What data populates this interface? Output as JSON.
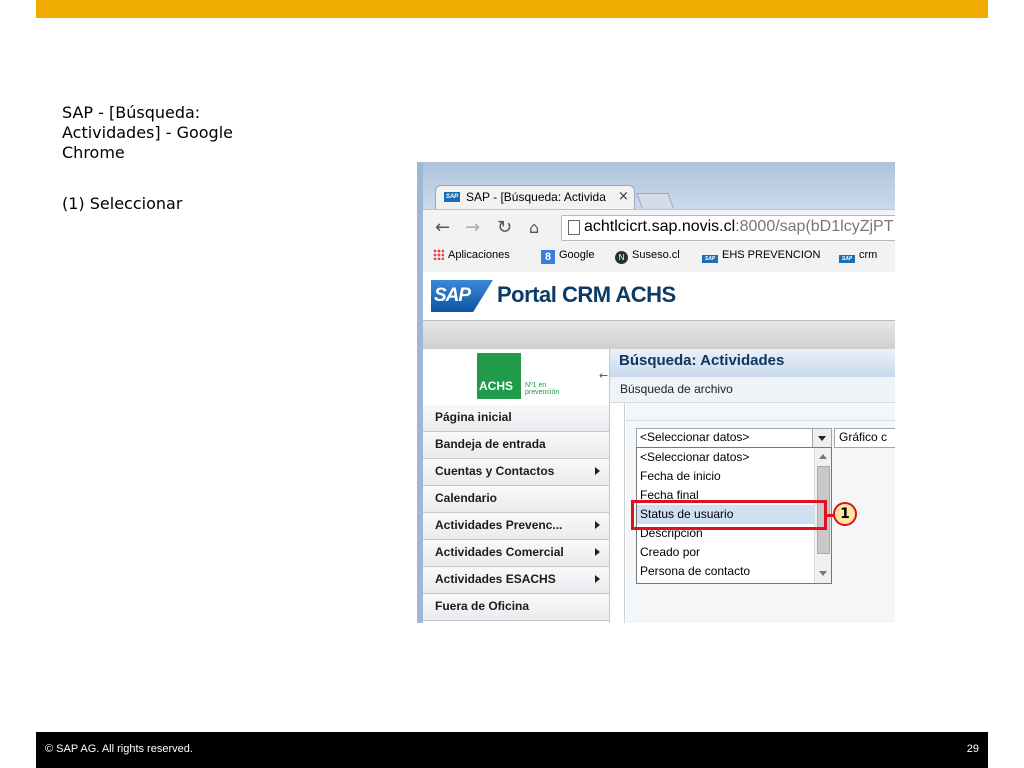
{
  "slide": {
    "title": "SAP - [Búsqueda: Actividades] - Google Chrome",
    "step": "(1) Seleccionar",
    "footer_copyright": "© SAP AG. All rights reserved.",
    "page_number": "29"
  },
  "browser": {
    "tab_title": "SAP - [Búsqueda: Activida",
    "tab_close": "×",
    "address_host": "achtlcicrt.sap.novis.cl",
    "address_path": ":8000/sap(bD1lcyZjPT",
    "bookmarks": [
      {
        "label": "Aplicaciones",
        "icon": "apps-icon"
      },
      {
        "label": "Google",
        "icon": "google-icon"
      },
      {
        "label": "Suseso.cl",
        "icon": "suseso-icon"
      },
      {
        "label": "EHS PREVENCION",
        "icon": "sap-icon"
      },
      {
        "label": "crm",
        "icon": "sap-icon"
      }
    ]
  },
  "portal": {
    "logo": "SAP",
    "title": "Portal CRM ACHS",
    "org_logo": "ACHS",
    "org_tagline_1": "Nº1 en",
    "org_tagline_2": "prevención"
  },
  "nav": {
    "items": [
      {
        "label": "Página inicial",
        "submenu": false
      },
      {
        "label": "Bandeja de entrada",
        "submenu": false
      },
      {
        "label": "Cuentas y Contactos",
        "submenu": true
      },
      {
        "label": "Calendario",
        "submenu": false
      },
      {
        "label": "Actividades Prevenc...",
        "submenu": true
      },
      {
        "label": "Actividades Comercial",
        "submenu": true
      },
      {
        "label": "Actividades ESACHS",
        "submenu": true
      },
      {
        "label": "Fuera de Oficina",
        "submenu": false
      }
    ]
  },
  "content": {
    "title": "Búsqueda: Actividades",
    "subtitle": "Búsqueda de archivo",
    "select_value": "<Seleccionar datos>",
    "graph_select_value": "Gráfico c",
    "options": [
      "<Seleccionar datos>",
      "Fecha de inicio",
      "Fecha final",
      "Status de usuario",
      "Descripción",
      "Creado por",
      "Persona de contacto"
    ],
    "selected_option_index": 3
  },
  "annotation": {
    "callout_number": "1",
    "highlight_color": "#e0101c"
  },
  "colors": {
    "top_bar": "#f0ab00",
    "footer": "#000000",
    "nav_title": "#0d3660"
  }
}
